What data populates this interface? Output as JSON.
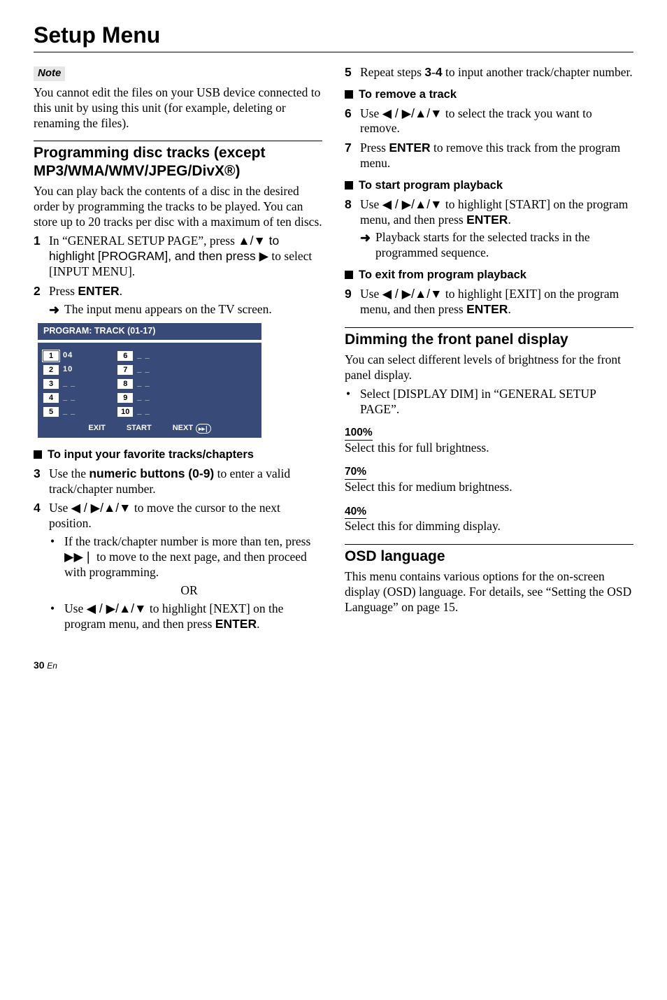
{
  "pageTitle": "Setup Menu",
  "note": {
    "label": "Note",
    "text": "You cannot edit the files on your USB device connected to this unit by using this unit (for example, deleting or renaming the files)."
  },
  "section_programming": {
    "heading": "Programming disc tracks (except MP3/WMA/WMV/JPEG/DivX®)",
    "intro": "You can play back the contents of a disc in the desired order by programming the tracks to be played. You can store up to 20 tracks per disc with a maximum of ten discs.",
    "step1_prefix": "In “GENERAL SETUP PAGE”, press ",
    "step1_mid": "▲/▼ to highlight [PROGRAM], and then press ",
    "step1_suffix": " to select [INPUT MENU].",
    "play_glyph": "▶",
    "step2_text": "Press ",
    "step2_btn": "ENTER",
    "step2_suffix": ".",
    "step2_arrow": "The input menu appears on the TV screen.",
    "sub_input": "To input your favorite tracks/chapters",
    "step3_pre": "Use the ",
    "step3_btn": "numeric buttons (0-9)",
    "step3_post": " to enter a valid track/chapter number.",
    "step4_pre": "Use ",
    "step4_glyphs": "◀ / ▶/▲/▼",
    "step4_post": " to move the cursor to the next position.",
    "step4_b1_pre": "If the track/chapter number is more than ten, press ",
    "step4_b1_glyph": "▶▶❘",
    "step4_b1_post": " to move to the next page, and then proceed with programming.",
    "or": "OR",
    "step4_b2_pre": "Use ",
    "step4_b2_glyphs": "◀ / ▶/▲/▼",
    "step4_b2_mid": " to highlight [NEXT] on the program menu, and then press ",
    "step4_b2_btn": "ENTER",
    "step4_b2_post": "."
  },
  "col2": {
    "step5_pre": "Repeat steps ",
    "step5_b1": "3",
    "step5_mid": "-",
    "step5_b2": "4",
    "step5_post": " to input another track/chapter number.",
    "sub_remove": "To remove a track",
    "step6_pre": "Use ",
    "step6_glyphs": "◀ / ▶/▲/▼",
    "step6_post": " to select the track you want to remove.",
    "step7_pre": "Press ",
    "step7_btn": "ENTER",
    "step7_post": " to remove this track from the program menu.",
    "sub_start": "To start program playback",
    "step8_pre": "Use ",
    "step8_glyphs": "◀ / ▶/▲/▼",
    "step8_mid": " to highlight [START] on the program menu, and then press ",
    "step8_btn": "ENTER",
    "step8_post": ".",
    "step8_arrow": "Playback starts for the selected tracks in the programmed sequence.",
    "sub_exit": "To exit from program playback",
    "step9_pre": "Use ",
    "step9_glyphs": "◀ / ▶/▲/▼",
    "step9_mid": " to highlight [EXIT] on the program menu, and then press ",
    "step9_btn": "ENTER",
    "step9_post": "."
  },
  "section_dim": {
    "heading": "Dimming the front panel display",
    "intro": "You can select different levels of brightness for the front panel display.",
    "bullet": "Select [DISPLAY DIM] in “GENERAL SETUP PAGE”.",
    "opt100": "100%",
    "opt100_desc": "Select this for full brightness.",
    "opt70": "70%",
    "opt70_desc": "Select this for medium brightness.",
    "opt40": "40%",
    "opt40_desc": "Select this for dimming display."
  },
  "section_osd": {
    "heading": "OSD language",
    "text": "This menu contains various options for the on-screen display (OSD) language. For details, see “Setting the OSD Language” on page 15."
  },
  "panel": {
    "header": "PROGRAM: TRACK (01-17)",
    "left": [
      {
        "n": "1",
        "v": "04",
        "sel": true
      },
      {
        "n": "2",
        "v": "10"
      },
      {
        "n": "3",
        "v": "_ _"
      },
      {
        "n": "4",
        "v": "_ _"
      },
      {
        "n": "5",
        "v": "_ _"
      }
    ],
    "right": [
      {
        "n": "6",
        "v": "_ _"
      },
      {
        "n": "7",
        "v": "_ _"
      },
      {
        "n": "8",
        "v": "_ _"
      },
      {
        "n": "9",
        "v": "_ _"
      },
      {
        "n": "10",
        "v": "_ _"
      }
    ],
    "buttons": {
      "exit": "EXIT",
      "start": "START",
      "next": "NEXT"
    }
  },
  "footer": {
    "page": "30",
    "lang": "En"
  }
}
